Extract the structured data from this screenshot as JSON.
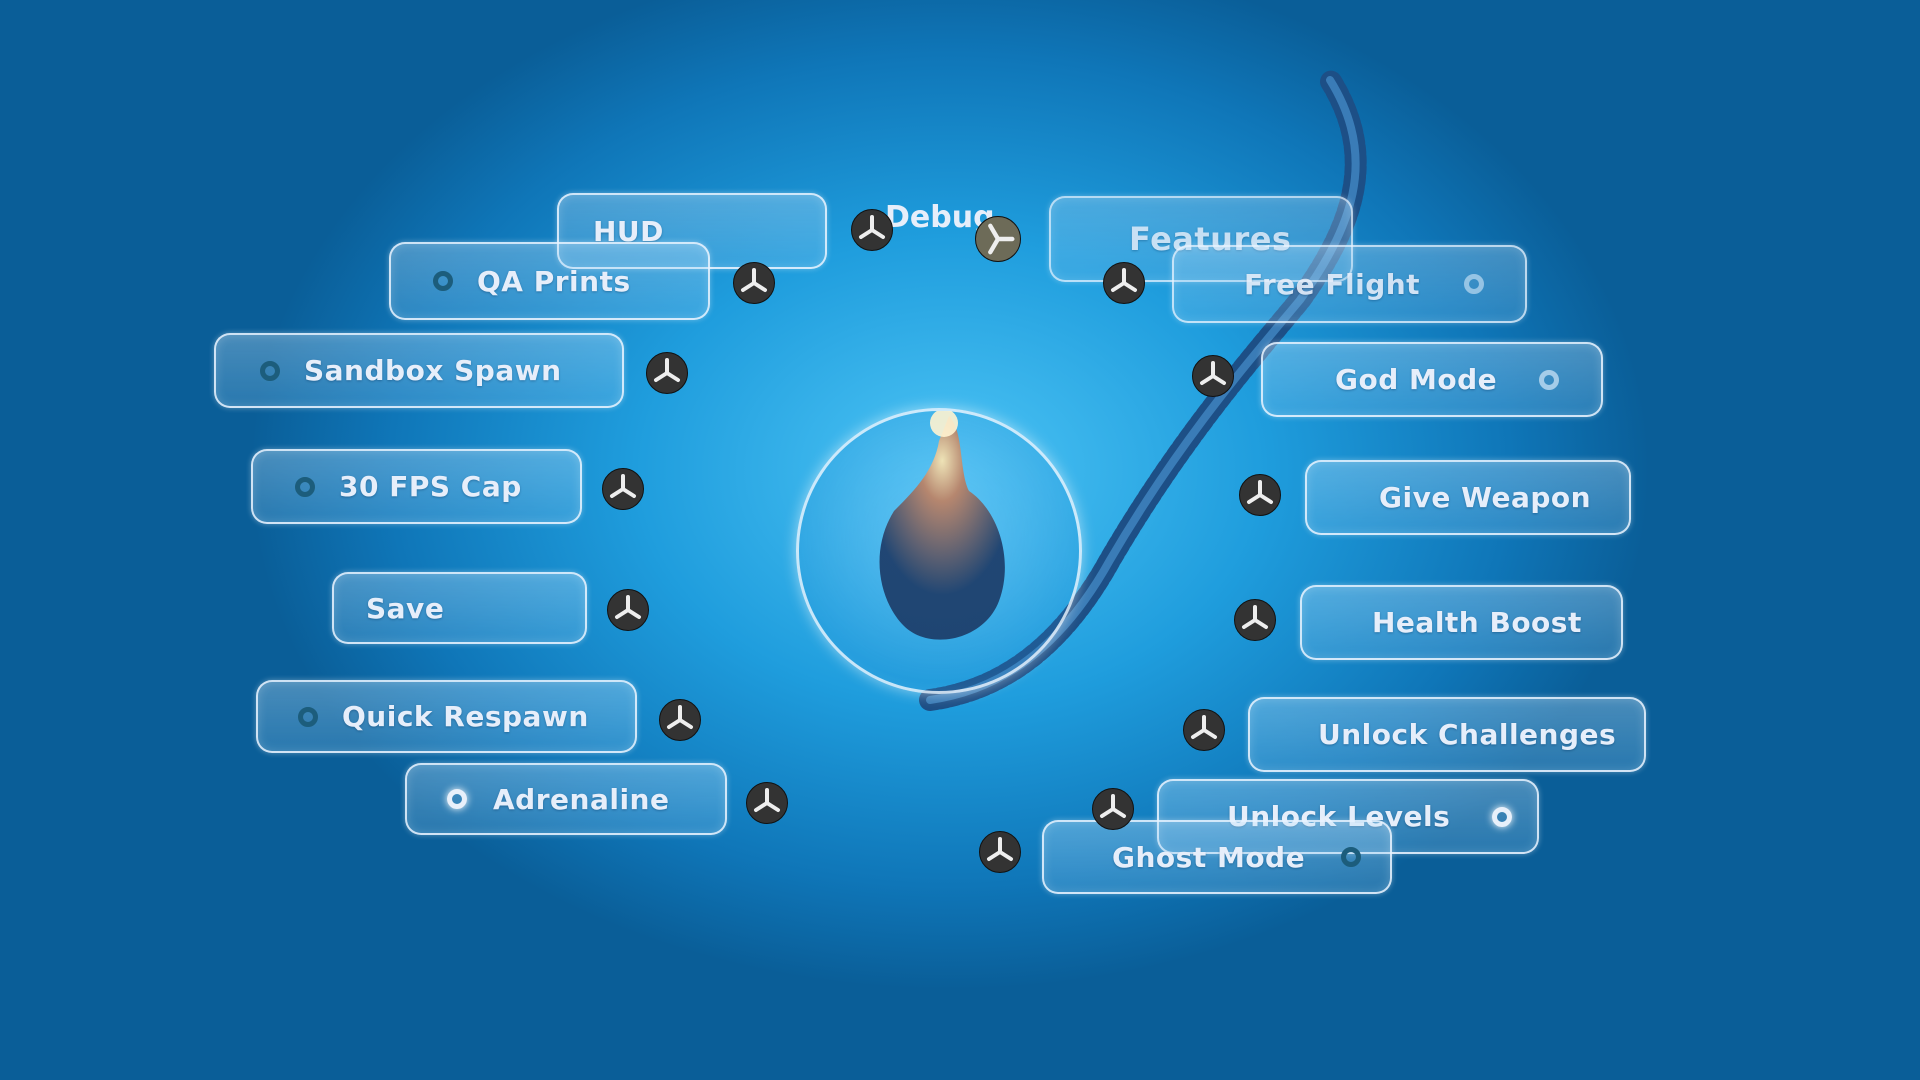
{
  "menu": {
    "center_label": "Debug",
    "left_items": [
      {
        "label": "HUD",
        "has_radio": false
      },
      {
        "label": "QA Prints",
        "has_radio": true,
        "selected": false
      },
      {
        "label": "Sandbox Spawn",
        "has_radio": true,
        "selected": false
      },
      {
        "label": "30 FPS Cap",
        "has_radio": true,
        "selected": false
      },
      {
        "label": "Save",
        "has_radio": false
      },
      {
        "label": "Quick Respawn",
        "has_radio": true,
        "selected": false
      },
      {
        "label": "Adrenaline",
        "has_radio": true,
        "selected": true
      }
    ],
    "right_items": [
      {
        "label": "Features",
        "has_radio": false
      },
      {
        "label": "Free Flight",
        "has_radio": true,
        "selected": false
      },
      {
        "label": "God Mode",
        "has_radio": true,
        "selected": false
      },
      {
        "label": "Give Weapon",
        "has_radio": false
      },
      {
        "label": "Health Boost",
        "has_radio": false
      },
      {
        "label": "Unlock Challenges",
        "has_radio": false
      },
      {
        "label": "Unlock Levels",
        "has_radio": true,
        "selected": true
      },
      {
        "label": "Ghost Mode",
        "has_radio": true,
        "selected": false
      }
    ]
  },
  "icons": {
    "knob": "tri-spoke-knob-icon",
    "radio": "radio-ring-icon",
    "center": "glowing-orb-hand-icon"
  },
  "colors": {
    "background": "#1f9ddd",
    "text": "#e6eefa",
    "radio_off": "#1c5d7c",
    "radio_on": "#e8f0fa"
  }
}
